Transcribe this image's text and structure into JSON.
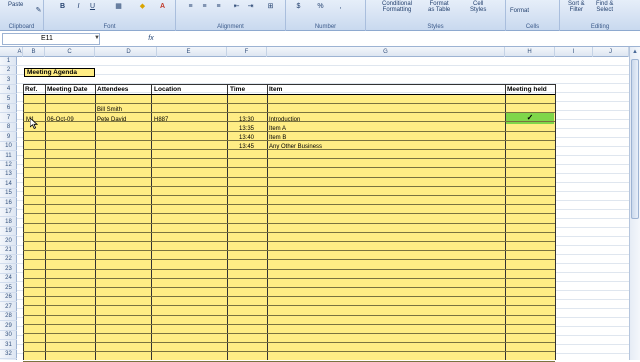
{
  "ribbon": {
    "clipboard": {
      "paste_label": "Paste",
      "group_label": "Clipboard"
    },
    "font": {
      "bold": "B",
      "italic": "I",
      "underline": "U",
      "group_label": "Font"
    },
    "alignment": {
      "group_label": "Alignment"
    },
    "number": {
      "currency": "$",
      "percent": "%",
      "group_label": "Number"
    },
    "styles": {
      "conditional_formatting": "Conditional\nFormatting",
      "format_as_table": "Format\nas Table",
      "cell_styles": "Cell\nStyles",
      "group_label": "Styles"
    },
    "cells": {
      "format_label": "Format",
      "group_label": "Cells"
    },
    "editing": {
      "sort_filter": "Sort &\nFilter",
      "find_select": "Find &\nSelect",
      "group_label": "Editing"
    }
  },
  "formula_bar": {
    "name_box": "E11",
    "fx_label": "fx",
    "formula": ""
  },
  "columns": [
    "A",
    "B",
    "C",
    "D",
    "E",
    "F",
    "G",
    "H",
    "I",
    "J"
  ],
  "rows": [
    "1",
    "2",
    "3",
    "4",
    "5",
    "6",
    "7",
    "8",
    "9",
    "10",
    "11",
    "12",
    "13",
    "14",
    "15",
    "16",
    "17",
    "18",
    "19",
    "20",
    "21",
    "22",
    "23",
    "24",
    "25",
    "26",
    "27",
    "28",
    "29",
    "30",
    "31",
    "32"
  ],
  "sheet": {
    "title": "Meeting Agenda",
    "headers": {
      "ref": "Ref.",
      "meeting_date": "Meeting Date",
      "attendees": "Attendees",
      "location": "Location",
      "time": "Time",
      "item": "Item",
      "meeting_held": "Meeting held"
    },
    "rows": [
      {
        "ref": "M1",
        "meeting_date": "06-Oct-09",
        "attendees_1": "Bill Smith",
        "attendees_2": "Pete David",
        "location": "H887",
        "time": "13:30",
        "item": "Introduction",
        "meeting_held": "✓"
      },
      {
        "time": "13:35",
        "item": "Item A"
      },
      {
        "time": "13:40",
        "item": "Item B"
      },
      {
        "time": "13:45",
        "item": "Any Other Business"
      }
    ]
  },
  "colors": {
    "table_fill": "#ffed85",
    "check_fill": "#7fd64a",
    "ribbon": "#c9d9ef"
  }
}
